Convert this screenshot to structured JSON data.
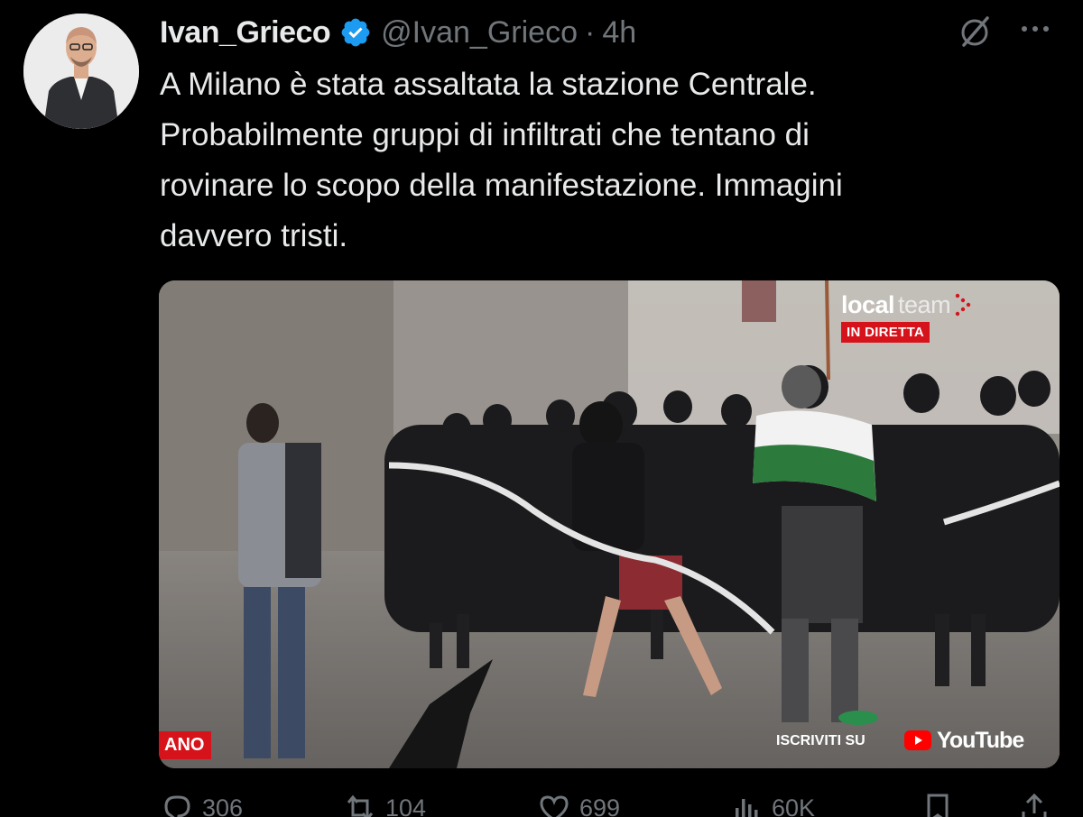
{
  "tweet": {
    "display_name": "Ivan_Grieco",
    "handle": "@Ivan_Grieco",
    "separator": "·",
    "time": "4h",
    "text_lines": [
      "A Milano è stata assaltata la stazione Centrale.",
      "Probabilmente gruppi di infiltrati che tentano di",
      "rovinare lo scopo della manifestazione. Immagini",
      "davvero tristi."
    ]
  },
  "media": {
    "logo_local": "local",
    "logo_team": "team",
    "live_badge": "IN DIRETTA",
    "channel_tag": "ANO",
    "subscribe_text": "ISCRIVITI SU",
    "youtube_label": "YouTube"
  },
  "actions": {
    "replies": "306",
    "reposts": "104",
    "likes": "699",
    "views": "60K"
  },
  "colors": {
    "background": "#000000",
    "text": "#e7e9ea",
    "muted": "#71767b",
    "verified": "#1d9bf0",
    "badge_red": "#d6131b"
  },
  "icons": [
    "verified-badge-icon",
    "grok-icon",
    "more-icon",
    "reply-icon",
    "repost-icon",
    "like-icon",
    "views-icon",
    "bookmark-icon",
    "share-icon"
  ]
}
